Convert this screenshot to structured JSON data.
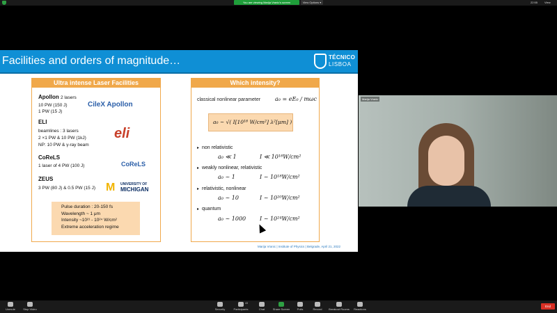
{
  "top": {
    "share_banner": "You are viewing Marija Vranic's screen",
    "view_options": "View Options ▾",
    "clock": "22:55",
    "view_label": "View"
  },
  "slide": {
    "title": "Facilities and orders of magnitude…",
    "logo_line1": "TÉCNICO",
    "logo_line2": "LISBOA",
    "left_header": "Ultra intense Laser Facilities",
    "apollon": {
      "name": "Apollon",
      "sub": "2 lasers",
      "lines": [
        "10 PW (150 J)",
        "1 PW (15 J)"
      ],
      "logo": "CileX Apollon"
    },
    "eli": {
      "name": "ELI",
      "lines": [
        "beamlines : 3 lasers",
        "2 ×1 PW & 10 PW (1kJ)",
        "NP: 10 PW & γ-ray beam"
      ],
      "logo": "eli"
    },
    "corels": {
      "name": "CoReLS",
      "lines": [
        "1 laser of 4 PW (100 J)"
      ],
      "logo": "CoReLS"
    },
    "zeus": {
      "name": "ZEUS",
      "lines": [
        "3 PW (80 J) & 0.5 PW (15 J)"
      ],
      "logo1": "M",
      "logo2": "UNIVERSITY OF",
      "logo3": "MICHIGAN"
    },
    "info": [
      "Pulse duration : 20-150 fs",
      "Wavelength ~ 1 μm",
      "Intensity ~10²¹ - 10²⁴ W/cm²",
      "Extreme acceleration regime"
    ],
    "right_header": "Which intensity?",
    "param_label": "classical nonlinear parameter",
    "param_formula": "a₀ = eE₀ / mωc",
    "box_formula": "a₀ ~ √( I[10¹⁸ W/cm²] λ²[μm] )",
    "regimes": [
      {
        "label": "non relativistic",
        "a0": "a₀ ≪ 1",
        "I": "I ≪ 10¹⁸W/cm²"
      },
      {
        "label": "weakly nonlinear, relativistic",
        "a0": "a₀ ~ 1",
        "I": "I ~ 10¹⁸W/cm²"
      },
      {
        "label": "relativistic, nonlinear",
        "a0": "a₀ ~ 10",
        "I": "I ~ 10²⁰W/cm²"
      },
      {
        "label": "quantum",
        "a0": "a₀ ~ 1000",
        "I": "I ~ 10²⁴W/cm²"
      }
    ],
    "caption": "Marija Vranic | Institute of Physics | Belgrade, April 21, 2022"
  },
  "webcam": {
    "name": "Marija Vranic"
  },
  "toolbar": [
    {
      "name": "unmute",
      "label": "Unmute"
    },
    {
      "name": "stop-video",
      "label": "Stop Video"
    },
    {
      "name": "security",
      "label": "Security"
    },
    {
      "name": "participants",
      "label": "Participants"
    },
    {
      "name": "chat",
      "label": "Chat"
    },
    {
      "name": "share-screen",
      "label": "Share Screen"
    },
    {
      "name": "polls",
      "label": "Polls"
    },
    {
      "name": "record",
      "label": "Record"
    },
    {
      "name": "breakout-rooms",
      "label": "Breakout Rooms"
    },
    {
      "name": "reactions",
      "label": "Reactions"
    }
  ],
  "participants_count": "43",
  "end_label": "End",
  "colors": {
    "slide_header": "#0f8fd5",
    "panel_border": "#f0a84a",
    "infobox": "#fbd9b0",
    "share_green": "#1f9e3a",
    "end_red": "#d93025"
  }
}
